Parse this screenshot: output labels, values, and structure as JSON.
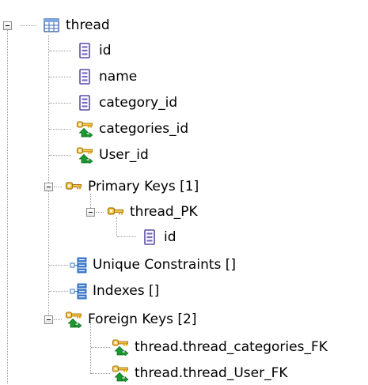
{
  "tree": {
    "root": {
      "label": "thread",
      "icon": "table-icon"
    },
    "columns": [
      {
        "label": "id",
        "icon": "column-icon"
      },
      {
        "label": "name",
        "icon": "column-icon"
      },
      {
        "label": "category_id",
        "icon": "column-icon"
      },
      {
        "label": "categories_id",
        "icon": "foreign-key-column-icon"
      },
      {
        "label": "User_id",
        "icon": "foreign-key-column-icon"
      }
    ],
    "primary_keys": {
      "label": "Primary Keys [1]",
      "icon": "key-icon",
      "key": {
        "label": "thread_PK",
        "icon": "key-icon",
        "columns": [
          {
            "label": "id",
            "icon": "column-icon"
          }
        ]
      }
    },
    "unique_constraints": {
      "label": "Unique Constraints []",
      "icon": "constraint-icon"
    },
    "indexes": {
      "label": "Indexes []",
      "icon": "index-icon"
    },
    "foreign_keys": {
      "label": "Foreign Keys [2]",
      "icon": "foreign-key-icon",
      "items": [
        {
          "label": "thread.thread_categories_FK",
          "icon": "foreign-key-icon"
        },
        {
          "label": "thread.thread_User_FK",
          "icon": "foreign-key-icon"
        }
      ]
    }
  },
  "colors": {
    "column_purple": "#7a6bc2",
    "key_gold": "#e5a81f",
    "fk_green": "#1a9a2e",
    "index_blue": "#2f74c9",
    "table_blue": "#4a7ec8",
    "tree_line": "#9a9a9a"
  }
}
